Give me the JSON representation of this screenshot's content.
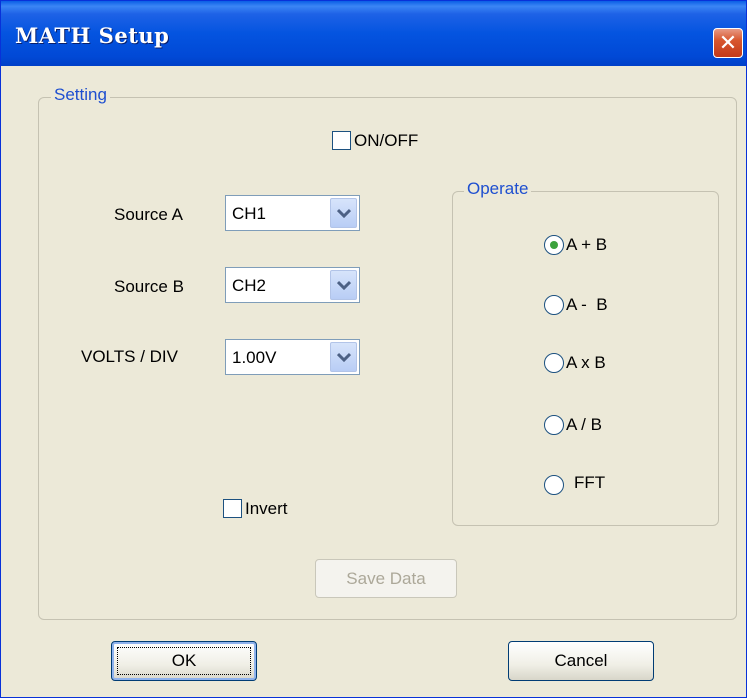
{
  "window": {
    "title": "MATH Setup",
    "close_icon": "close-icon"
  },
  "setting_group": {
    "legend": "Setting",
    "on_off": {
      "label": "ON/OFF",
      "checked": false
    },
    "source_a": {
      "label": "Source A",
      "value": "CH1"
    },
    "source_b": {
      "label": "Source B",
      "value": "CH2"
    },
    "volts_div": {
      "label": "VOLTS / DIV",
      "value": "1.00V"
    },
    "invert": {
      "label": "Invert",
      "checked": false
    },
    "save_data_label": "Save Data"
  },
  "operate_group": {
    "legend": "Operate",
    "options": [
      {
        "label": "A + B",
        "selected": true
      },
      {
        "label": "A -  B",
        "selected": false
      },
      {
        "label": "A x B",
        "selected": false
      },
      {
        "label": "A / B",
        "selected": false
      },
      {
        "label": "FFT",
        "selected": false
      }
    ]
  },
  "buttons": {
    "ok_label": "OK",
    "cancel_label": "Cancel"
  },
  "colors": {
    "titlebar": "#0454e0",
    "legend_text": "#1e4fd0",
    "dialog_bg": "#ece9d8",
    "radio_selected": "#3ca23c"
  }
}
